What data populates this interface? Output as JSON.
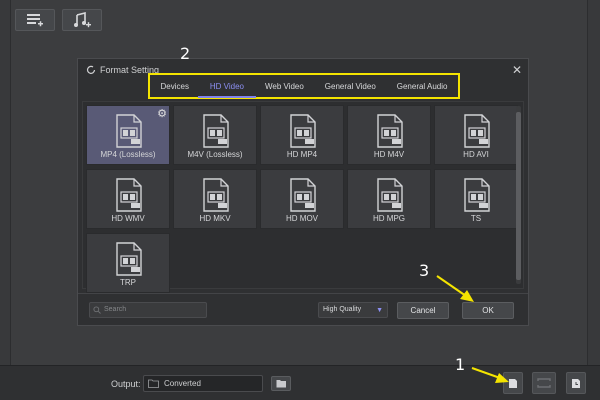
{
  "dialog": {
    "title": "Format Setting",
    "tabs": [
      {
        "label": "Devices",
        "active": false
      },
      {
        "label": "HD Video",
        "active": true
      },
      {
        "label": "Web Video",
        "active": false
      },
      {
        "label": "General Video",
        "active": false
      },
      {
        "label": "General Audio",
        "active": false
      }
    ],
    "formats": [
      {
        "label": "MP4 (Lossless)",
        "selected": true
      },
      {
        "label": "M4V (Lossless)"
      },
      {
        "label": "HD MP4"
      },
      {
        "label": "HD M4V"
      },
      {
        "label": "HD AVI"
      },
      {
        "label": "HD WMV"
      },
      {
        "label": "HD MKV"
      },
      {
        "label": "HD MOV"
      },
      {
        "label": "HD MPG"
      },
      {
        "label": "TS"
      },
      {
        "label": "TRP"
      }
    ],
    "search_placeholder": "Search",
    "quality_selected": "High Quality",
    "cancel_label": "Cancel",
    "ok_label": "OK"
  },
  "bottom_bar": {
    "output_label": "Output:",
    "output_value": "Converted"
  },
  "annotations": {
    "one": "1",
    "two": "2",
    "three": "3"
  },
  "colors": {
    "accent": "#8c8ff2",
    "highlight_box": "#f4e400",
    "annotation_arrow": "#f4e400"
  }
}
